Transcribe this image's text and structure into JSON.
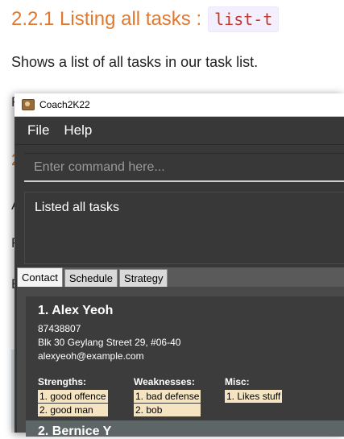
{
  "doc": {
    "heading": "2.2.1 Listing all tasks :",
    "heading_code": "list-t",
    "paragraph": "Shows a list of all tasks in our task list.",
    "peek_letters": [
      "F",
      "2",
      "A",
      "F",
      "E"
    ]
  },
  "window": {
    "title": "Coach2K22"
  },
  "menu": {
    "items": [
      "File",
      "Help"
    ]
  },
  "command": {
    "placeholder": "Enter command here...",
    "value": ""
  },
  "result": {
    "text": "Listed all tasks"
  },
  "tabs": [
    {
      "label": "Contact",
      "active": true
    },
    {
      "label": "Schedule",
      "active": false
    },
    {
      "label": "Strategy",
      "active": false
    }
  ],
  "contacts": [
    {
      "index_name": "1.  Alex Yeoh",
      "phone": "87438807",
      "address": "Blk 30 Geylang Street 29, #06-40",
      "email": "alexyeoh@example.com",
      "strengths_label": "Strengths:",
      "weaknesses_label": "Weaknesses:",
      "misc_label": "Misc:",
      "strengths": [
        "1. good offence",
        "2. good man"
      ],
      "weaknesses": [
        "1. bad defense",
        "2. bob"
      ],
      "misc": [
        "1. Likes stuff"
      ]
    },
    {
      "index_name": "2.  Bernice Y"
    }
  ],
  "colors": {
    "accent_heading": "#e0782f",
    "app_background": "#383838",
    "tag_background": "#f4e4c1"
  }
}
